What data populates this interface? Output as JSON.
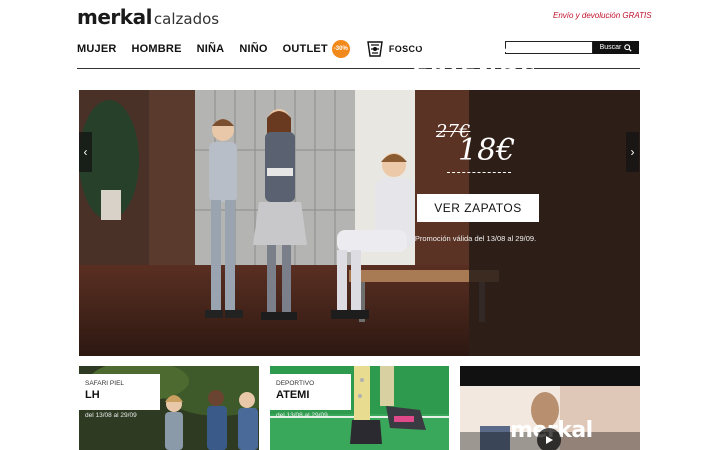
{
  "header": {
    "logo_main": "merkal",
    "logo_sub": "calzados",
    "promo_text": "Envío y devolución GRATIS"
  },
  "nav": {
    "items": [
      {
        "label": "MUJER"
      },
      {
        "label": "HOMBRE"
      },
      {
        "label": "NIÑA"
      },
      {
        "label": "NIÑO"
      }
    ],
    "outlet": {
      "label": "OUTLET",
      "badge": "-30%"
    },
    "fosco": {
      "label": "FOSCO"
    }
  },
  "search": {
    "placeholder": "",
    "button_label": "Buscar"
  },
  "hero": {
    "title_line1": "~COOL~",
    "title_line2": "FRIENDS",
    "price_old": "27€",
    "price_new": "18€",
    "cta_label": "VER ZAPATOS",
    "validity": "Promoción válida del 13/08 al 29/09.",
    "arrow_left": "‹",
    "arrow_right": "›"
  },
  "cards": [
    {
      "kicker": "SAFARI PIEL",
      "name": "LH",
      "dates": "del 13/08 al 29/09"
    },
    {
      "kicker": "DEPORTIVO",
      "name": "ATEMI",
      "dates": "del 13/08 al 29/09"
    },
    {
      "logo": "merkal"
    }
  ],
  "colors": {
    "promo_red": "#c0102a",
    "outlet_orange": "#f28a1b",
    "hero_panel": "#241a16",
    "accent_green": "#2e9a4e"
  }
}
